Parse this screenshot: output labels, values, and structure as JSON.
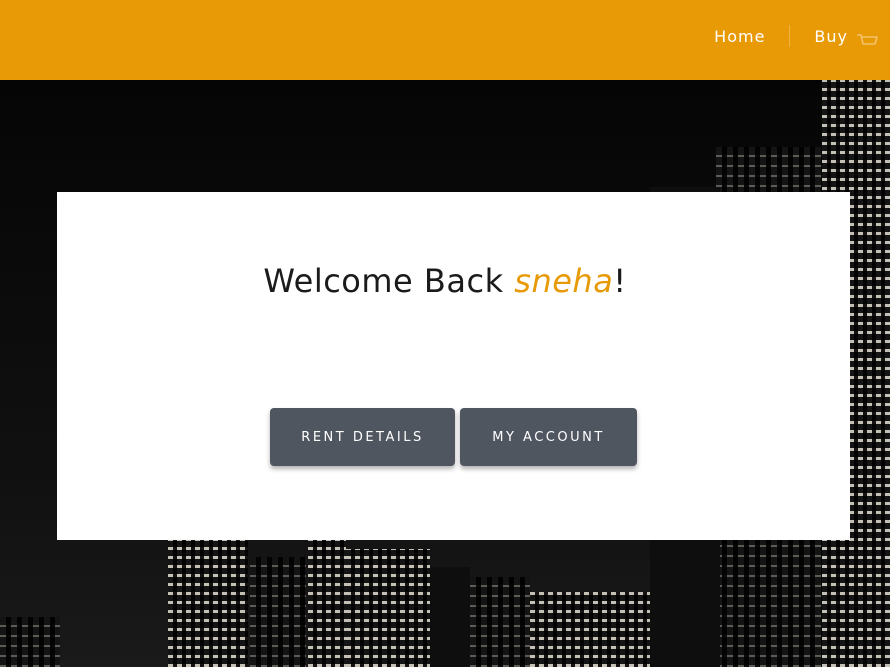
{
  "navbar": {
    "links": [
      "Home",
      "Buy"
    ],
    "cart_icon": "cart-icon",
    "color": "#e89a06"
  },
  "main": {
    "welcome_prefix": "Welcome Back ",
    "username": "sneha",
    "welcome_suffix": "!",
    "buttons": {
      "rent_details": "RENT DETAILS",
      "my_account": "MY ACCOUNT"
    }
  },
  "colors": {
    "accent": "#e89a06",
    "button": "#505660"
  }
}
